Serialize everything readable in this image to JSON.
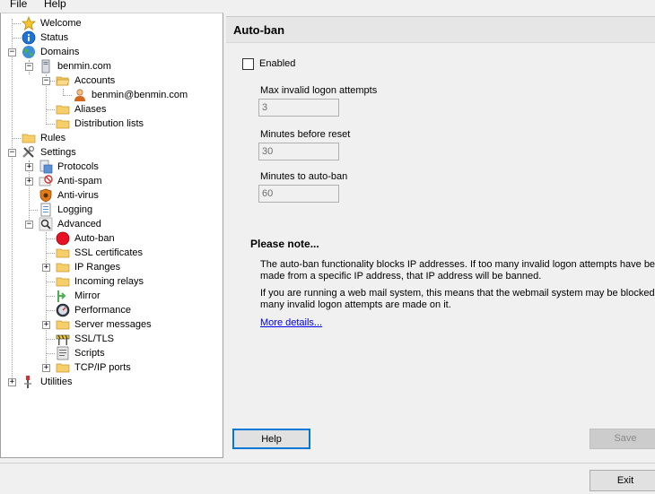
{
  "menu": {
    "file": "File",
    "help": "Help"
  },
  "tree": {
    "welcome": "Welcome",
    "status": "Status",
    "domains": "Domains",
    "domain": "benmin.com",
    "accounts": "Accounts",
    "account": "benmin@benmin.com",
    "aliases": "Aliases",
    "distribution_lists": "Distribution lists",
    "rules": "Rules",
    "settings": "Settings",
    "protocols": "Protocols",
    "anti_spam": "Anti-spam",
    "anti_virus": "Anti-virus",
    "logging": "Logging",
    "advanced": "Advanced",
    "auto_ban": "Auto-ban",
    "ssl_certificates": "SSL certificates",
    "ip_ranges": "IP Ranges",
    "incoming_relays": "Incoming relays",
    "mirror": "Mirror",
    "performance": "Performance",
    "server_messages": "Server messages",
    "ssl_tls": "SSL/TLS",
    "scripts": "Scripts",
    "tcpip_ports": "TCP/IP ports",
    "utilities": "Utilities"
  },
  "panel": {
    "title": "Auto-ban",
    "enabled_label": "Enabled",
    "enabled_checked": false,
    "max_invalid_label": "Max invalid logon attempts",
    "max_invalid_value": "3",
    "minutes_reset_label": "Minutes before reset",
    "minutes_reset_value": "30",
    "minutes_autoban_label": "Minutes to auto-ban",
    "minutes_autoban_value": "60",
    "note_title": "Please note...",
    "note_line1": "The auto-ban functionality blocks IP addresses. If too many invalid logon attempts have been",
    "note_line2": "made from a specific IP address, that IP address will be banned.",
    "note_line3": "If you are running a web mail system, this means that the webmail system may be blocked, if to",
    "note_line4": "many invalid logon attempts are made on it.",
    "more_details": "More details..."
  },
  "buttons": {
    "help": "Help",
    "save": "Save",
    "exit": "Exit"
  },
  "colors": {
    "focus_border": "#0078d7",
    "link": "#0000ee",
    "autoban_icon": "#e81123"
  }
}
